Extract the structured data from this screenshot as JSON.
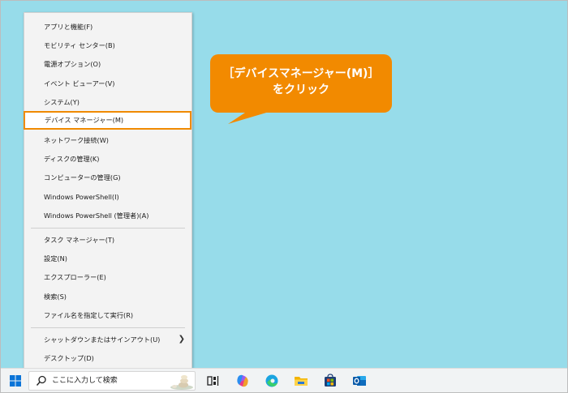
{
  "context_menu": {
    "items": [
      {
        "label": "アプリと機能(F)"
      },
      {
        "label": "モビリティ センター(B)"
      },
      {
        "label": "電源オプション(O)"
      },
      {
        "label": "イベント ビューアー(V)"
      },
      {
        "label": "システム(Y)"
      },
      {
        "label": "デバイス マネージャー(M)"
      },
      {
        "label": "ネットワーク接続(W)"
      },
      {
        "label": "ディスクの管理(K)"
      },
      {
        "label": "コンピューターの管理(G)"
      },
      {
        "label": "Windows PowerShell(I)"
      },
      {
        "label": "Windows PowerShell (管理者)(A)"
      },
      {
        "label": "タスク マネージャー(T)"
      },
      {
        "label": "設定(N)"
      },
      {
        "label": "エクスプローラー(E)"
      },
      {
        "label": "検索(S)"
      },
      {
        "label": "ファイル名を指定して実行(R)"
      },
      {
        "label": "シャットダウンまたはサインアウト(U)"
      },
      {
        "label": "デスクトップ(D)"
      }
    ],
    "selected_index": 5
  },
  "callout": {
    "line1": "［デバイスマネージャー(M)］",
    "line2": "をクリック"
  },
  "taskbar": {
    "search_placeholder": "ここに入力して検索",
    "icons": [
      "windows-start-icon",
      "search-icon",
      "task-view-icon",
      "copilot-icon",
      "edge-icon",
      "file-explorer-icon",
      "microsoft-store-icon",
      "outlook-icon"
    ]
  },
  "colors": {
    "desktop": "#97dcea",
    "highlight_border": "#f08a00",
    "callout": "#f28a00"
  }
}
